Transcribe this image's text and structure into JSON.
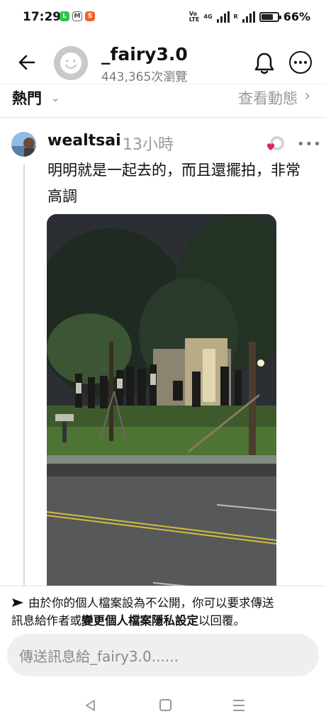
{
  "status_bar": {
    "time": "17:29",
    "network_label_top": "Vo",
    "network_label_bottom": "LTE",
    "network_type": "4G",
    "roaming": "R",
    "battery_percent": "66%",
    "battery_level": 0.66,
    "app_icons": [
      "line-icon",
      "gmail-icon",
      "shopee-icon"
    ]
  },
  "header": {
    "title": "_fairy3.0",
    "subtitle": "443,365次瀏覽"
  },
  "filter_bar": {
    "sort_label": "熱門",
    "view_activity_label": "查看動態"
  },
  "post": {
    "author": "wealtsai",
    "time_ago": "13小時",
    "text": "明明就是一起去的，而且還擺拍，非常高調",
    "accent_color": "#e0245e"
  },
  "notice": {
    "part1": "由於你的個人檔案設為不公開，你可以要求傳送",
    "part2": "訊息給作者或",
    "link": "變更個人檔案隱私設定",
    "part3": "以回覆。"
  },
  "composer": {
    "placeholder": "傳送訊息給_fairy3.0......"
  }
}
